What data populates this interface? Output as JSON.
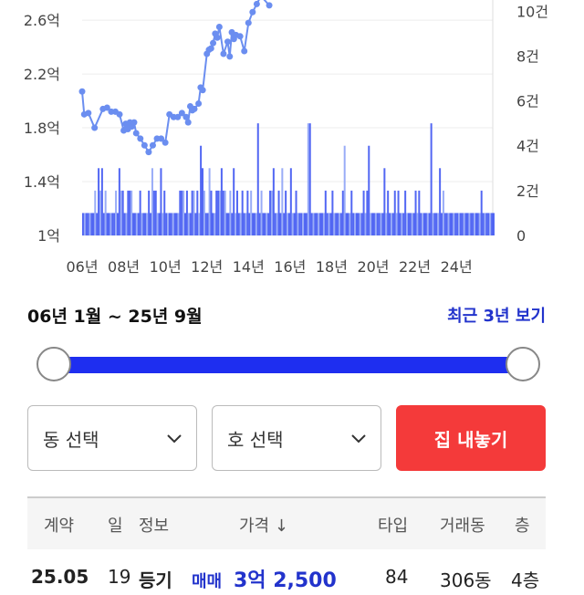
{
  "chart_data": {
    "type": "line+bar",
    "y_left_ticks": [
      "1억",
      "1.4억",
      "1.8억",
      "2.2억",
      "2.6억"
    ],
    "y_right_ticks": [
      "0",
      "2건",
      "4건",
      "6건",
      "8건",
      "10건"
    ],
    "x_ticks": [
      "06년",
      "08년",
      "10년",
      "12년",
      "14년",
      "16년",
      "18년",
      "20년",
      "22년",
      "24년"
    ],
    "price_series": {
      "x": [
        2006.0,
        2006.1,
        2006.3,
        2006.6,
        2007.0,
        2007.2,
        2007.4,
        2007.6,
        2007.8,
        2008.0,
        2008.1,
        2008.2,
        2008.3,
        2008.4,
        2008.5,
        2008.6,
        2008.8,
        2009.0,
        2009.2,
        2009.4,
        2009.6,
        2009.8,
        2010.0,
        2010.2,
        2010.4,
        2010.6,
        2010.8,
        2011.0,
        2011.1,
        2011.2,
        2011.3,
        2011.4,
        2011.6,
        2011.7,
        2011.8,
        2012.0,
        2012.1,
        2012.2,
        2012.3,
        2012.4,
        2012.5,
        2012.6,
        2012.8,
        2013.0,
        2013.1,
        2013.2,
        2013.3,
        2013.4,
        2013.6,
        2013.8,
        2014.0,
        2014.2,
        2014.4,
        2014.6,
        2015.0
      ],
      "values": [
        2.07,
        1.9,
        1.91,
        1.8,
        1.94,
        1.95,
        1.92,
        1.92,
        1.9,
        1.78,
        1.83,
        1.79,
        1.84,
        1.81,
        1.84,
        1.76,
        1.72,
        1.67,
        1.62,
        1.67,
        1.72,
        1.72,
        1.69,
        1.9,
        1.88,
        1.88,
        1.91,
        1.88,
        1.84,
        1.96,
        1.93,
        1.94,
        1.98,
        2.1,
        2.08,
        2.35,
        2.38,
        2.39,
        2.43,
        2.5,
        2.47,
        2.55,
        2.35,
        2.44,
        2.33,
        2.51,
        2.46,
        2.49,
        2.48,
        2.37,
        2.58,
        2.66,
        2.72,
        2.78,
        2.71
      ],
      "unit": "억",
      "color": "#6b8ef0",
      "ylim": [
        1.0,
        2.75
      ]
    },
    "volume_series": {
      "x_start": 2006.0,
      "x_step": 0.08333,
      "values": [
        1,
        1,
        1,
        1,
        1,
        1,
        1,
        2,
        1,
        3,
        2,
        3,
        1,
        2,
        1,
        1,
        1,
        1,
        1,
        2,
        1,
        3,
        2,
        2,
        1,
        1,
        2,
        2,
        2,
        1,
        1,
        1,
        1,
        2,
        1,
        1,
        1,
        1,
        2,
        1,
        3,
        2,
        2,
        1,
        1,
        3,
        1,
        2,
        1,
        1,
        1,
        1,
        1,
        1,
        1,
        1,
        2,
        2,
        2,
        1,
        2,
        1,
        1,
        2,
        2,
        1,
        2,
        1,
        4,
        3,
        2,
        1,
        1,
        3,
        2,
        1,
        1,
        2,
        2,
        2,
        3,
        2,
        2,
        1,
        1,
        2,
        1,
        3,
        1,
        2,
        1,
        1,
        2,
        1,
        1,
        2,
        1,
        2,
        1,
        1,
        1,
        5,
        1,
        2,
        1,
        1,
        1,
        1,
        2,
        2,
        3,
        1,
        1,
        2,
        1,
        3,
        1,
        2,
        1,
        1,
        3,
        1,
        1,
        2,
        1,
        1,
        1,
        1,
        1,
        1,
        5,
        5,
        1,
        1,
        1,
        1,
        1,
        1,
        1,
        1,
        2,
        1,
        1,
        1,
        2,
        1,
        1,
        1,
        1,
        1,
        2,
        4,
        1,
        1,
        1,
        2,
        1,
        1,
        1,
        1,
        1,
        1,
        2,
        1,
        2,
        4,
        1,
        1,
        1,
        1,
        1,
        1,
        1,
        1,
        3,
        1,
        2,
        1,
        1,
        1,
        2,
        1,
        2,
        1,
        1,
        1,
        2,
        1,
        1,
        1,
        1,
        1,
        2,
        1,
        2,
        1,
        1,
        1,
        1,
        1,
        1,
        5,
        1,
        1,
        1,
        1,
        3,
        1,
        2,
        1,
        1,
        1,
        1,
        1,
        1,
        1,
        1,
        1,
        1,
        1,
        1,
        1,
        1,
        1,
        1,
        1,
        1,
        1,
        1,
        1,
        2,
        1,
        1,
        1,
        1,
        1,
        1,
        1,
        2,
        1,
        1,
        1,
        1,
        1,
        1,
        1,
        1,
        1,
        1,
        2,
        1,
        1,
        1,
        1,
        1,
        1,
        1,
        1,
        1,
        1,
        3,
        1,
        1,
        1,
        2
      ],
      "unit": "건",
      "colors": [
        "#3f56f2",
        "#8ea3f6"
      ],
      "ylim": [
        0,
        10.5
      ]
    },
    "xlim": [
      2006.0,
      2025.75
    ]
  },
  "range": {
    "label": "06년 1월 ~ 25년 9월",
    "recent_link": "최근 3년 보기",
    "start": 0.0,
    "end": 1.0
  },
  "controls": {
    "dong_select": "동 선택",
    "ho_select": "호 선택",
    "sell_button": "집 내놓기"
  },
  "table": {
    "headers": [
      "계약",
      "일",
      "정보",
      "가격 ↓",
      "타입",
      "거래동",
      "층"
    ],
    "rows": [
      {
        "contract": "25.05",
        "day": "19",
        "info": "등기",
        "trade_type": "매매",
        "price": "3억 2,500",
        "type": "84",
        "dong": "306동",
        "floor": "4층"
      }
    ]
  },
  "colors": {
    "accent": "#1e2ef0",
    "sell": "#f43a3a",
    "link": "#2233cc"
  }
}
